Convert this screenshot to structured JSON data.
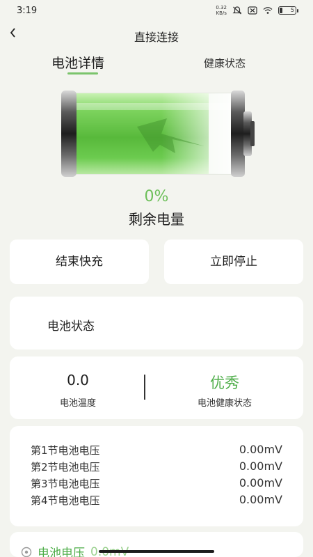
{
  "status_bar": {
    "time": "3:19",
    "net_speed_value": "0.32",
    "net_speed_unit": "KB/s",
    "battery_level": "5"
  },
  "header": {
    "title": "直接连接"
  },
  "tabs": {
    "detail": "电池详情",
    "health": "健康状态",
    "active": "detail"
  },
  "battery": {
    "percent": "0%",
    "remaining_label": "剩余电量"
  },
  "actions": {
    "end_fast_charge": "结束快充",
    "stop_now": "立即停止"
  },
  "status_card": {
    "label": "电池状态"
  },
  "metrics": {
    "temperature_value": "0.0",
    "temperature_label": "电池温度",
    "health_value": "优秀",
    "health_label": "电池健康状态"
  },
  "cells": [
    {
      "name": "第1节电池电压",
      "value": "0.00mV"
    },
    {
      "name": "第2节电池电压",
      "value": "0.00mV"
    },
    {
      "name": "第3节电池电压",
      "value": "0.00mV"
    },
    {
      "name": "第4节电池电压",
      "value": "0.00mV"
    }
  ],
  "bottom_card": {
    "label": "电池电压",
    "value": "0.0mV"
  },
  "colors": {
    "accent_green": "#6cbf59",
    "health_green": "#4fae4a",
    "background": "#f3f4ef"
  }
}
